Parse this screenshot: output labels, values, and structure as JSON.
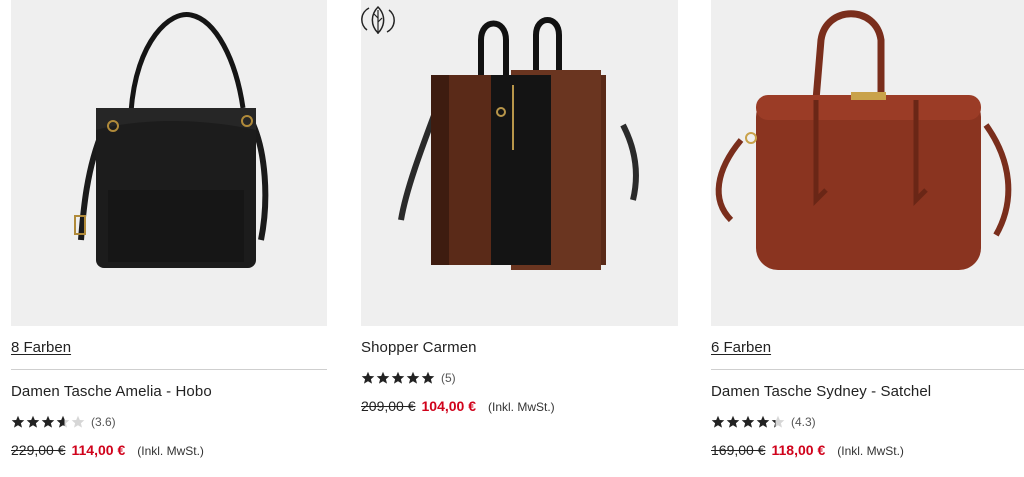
{
  "products": [
    {
      "colors_label": "8 Farben",
      "name": "Damen Tasche Amelia - Hobo",
      "rating": 3.6,
      "rating_text": "(3.6)",
      "old_price": "229,00 €",
      "new_price": "114,00 €",
      "tax_note": "(Inkl. MwSt.)",
      "bag_color": "#1c1c1c"
    },
    {
      "eco_badge_icon": "leaf-recycle-icon",
      "name": "Shopper Carmen",
      "rating": 5,
      "rating_text": "(5)",
      "old_price": "209,00 €",
      "new_price": "104,00 €",
      "tax_note": "(Inkl. MwSt.)",
      "bag_color": "#5a2a18"
    },
    {
      "colors_label": "6 Farben",
      "name": "Damen Tasche Sydney - Satchel",
      "rating": 4.3,
      "rating_text": "(4.3)",
      "old_price": "169,00 €",
      "new_price": "118,00 €",
      "tax_note": "(Inkl. MwSt.)",
      "bag_color": "#8a3420"
    }
  ],
  "colors": {
    "sale_red": "#d0021b",
    "image_bg": "#efefef",
    "star": "#222222"
  }
}
